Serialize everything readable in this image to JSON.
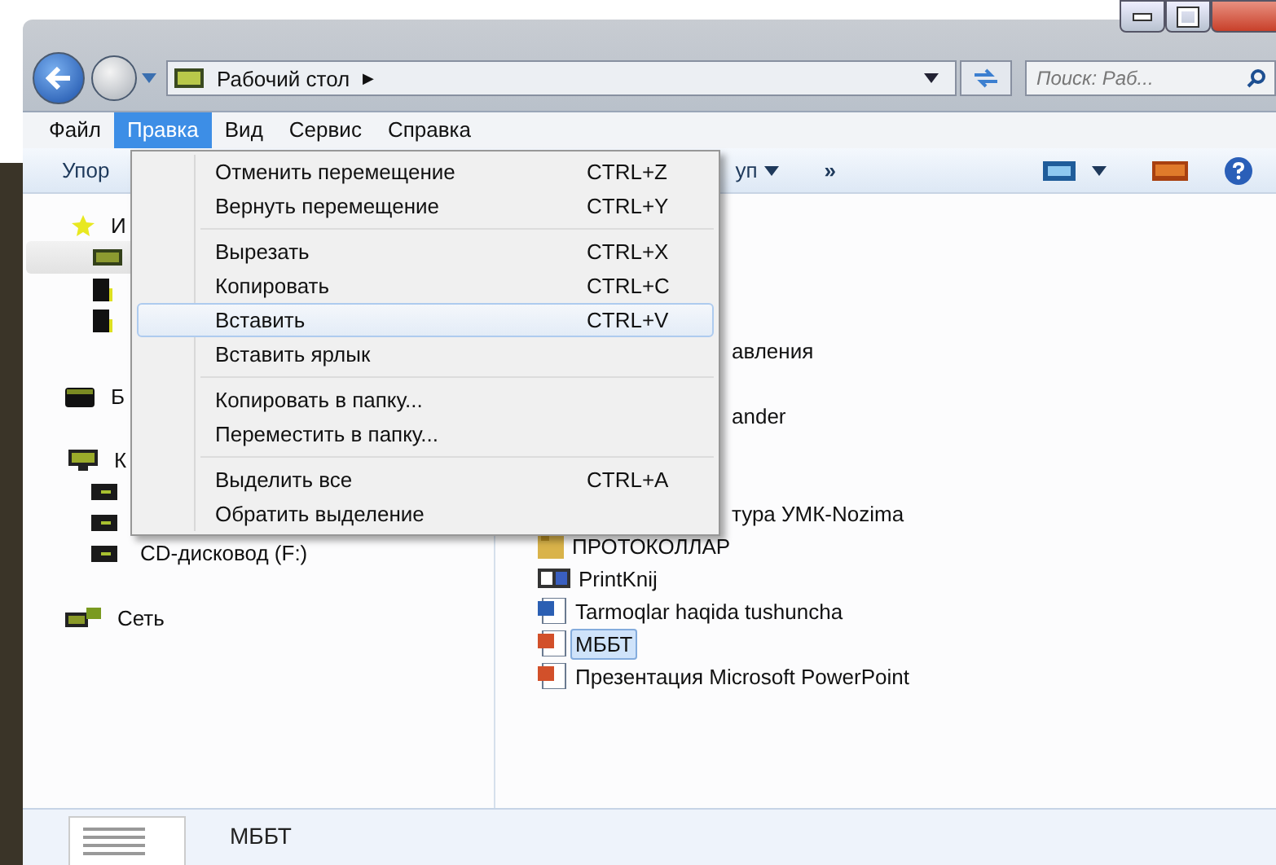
{
  "address_bar": {
    "location": "Рабочий стол",
    "separator": "▶",
    "search_placeholder": "Поиск: Раб..."
  },
  "menu_bar": [
    {
      "label": "Файл",
      "selected": false
    },
    {
      "label": "Правка",
      "selected": true
    },
    {
      "label": "Вид",
      "selected": false
    },
    {
      "label": "Сервис",
      "selected": false
    },
    {
      "label": "Справка",
      "selected": false
    }
  ],
  "toolbar": {
    "organize_fragment": "Упор",
    "access_fragment": "уп",
    "more": "»"
  },
  "sidebar": [
    {
      "kind": "star",
      "label": "И",
      "selected": false
    },
    {
      "kind": "desk",
      "selected": true
    },
    {
      "kind": "blank",
      "selected": false
    },
    {
      "kind": "blank",
      "selected": false
    },
    {
      "kind": "lib",
      "label": "Б",
      "selected": false
    },
    {
      "kind": "pc",
      "label": "К",
      "selected": false
    },
    {
      "kind": "drive",
      "selected": false
    },
    {
      "kind": "drive",
      "selected": false
    },
    {
      "kind": "drive",
      "label": "CD-дисковод (F:)",
      "selected": false
    },
    {
      "kind": "net",
      "label": "Сеть",
      "selected": false
    }
  ],
  "files": [
    {
      "kind": "cut",
      "name": "авления",
      "selected": false
    },
    {
      "kind": "cut",
      "name": "ander",
      "selected": false
    },
    {
      "kind": "cut",
      "name": "тура УМК-Nozima",
      "selected": false
    },
    {
      "kind": "folder",
      "name": "ПРОТОКОЛЛАР",
      "selected": false
    },
    {
      "kind": "book",
      "name": "PrintKnij",
      "selected": false
    },
    {
      "kind": "word",
      "name": "Tarmoqlar haqida tushuncha",
      "selected": false
    },
    {
      "kind": "ppt",
      "name": "МББТ",
      "selected": true
    },
    {
      "kind": "ppt",
      "name": "Презентация Microsoft PowerPoint",
      "selected": false
    }
  ],
  "edit_menu": [
    [
      {
        "label": "Отменить перемещение",
        "shortcut": "CTRL+Z",
        "selected": false
      },
      {
        "label": "Вернуть перемещение",
        "shortcut": "CTRL+Y",
        "selected": false
      }
    ],
    [
      {
        "label": "Вырезать",
        "shortcut": "CTRL+X",
        "selected": false
      },
      {
        "label": "Копировать",
        "shortcut": "CTRL+C",
        "selected": false
      },
      {
        "label": "Вставить",
        "shortcut": "CTRL+V",
        "selected": true
      },
      {
        "label": "Вставить ярлык",
        "selected": false
      }
    ],
    [
      {
        "label": "Копировать в папку...",
        "selected": false
      },
      {
        "label": "Переместить в папку...",
        "selected": false
      }
    ],
    [
      {
        "label": "Выделить все",
        "shortcut": "CTRL+A",
        "selected": false
      },
      {
        "label": "Обратить выделение",
        "selected": false
      }
    ]
  ],
  "details": {
    "name": "МББТ"
  }
}
